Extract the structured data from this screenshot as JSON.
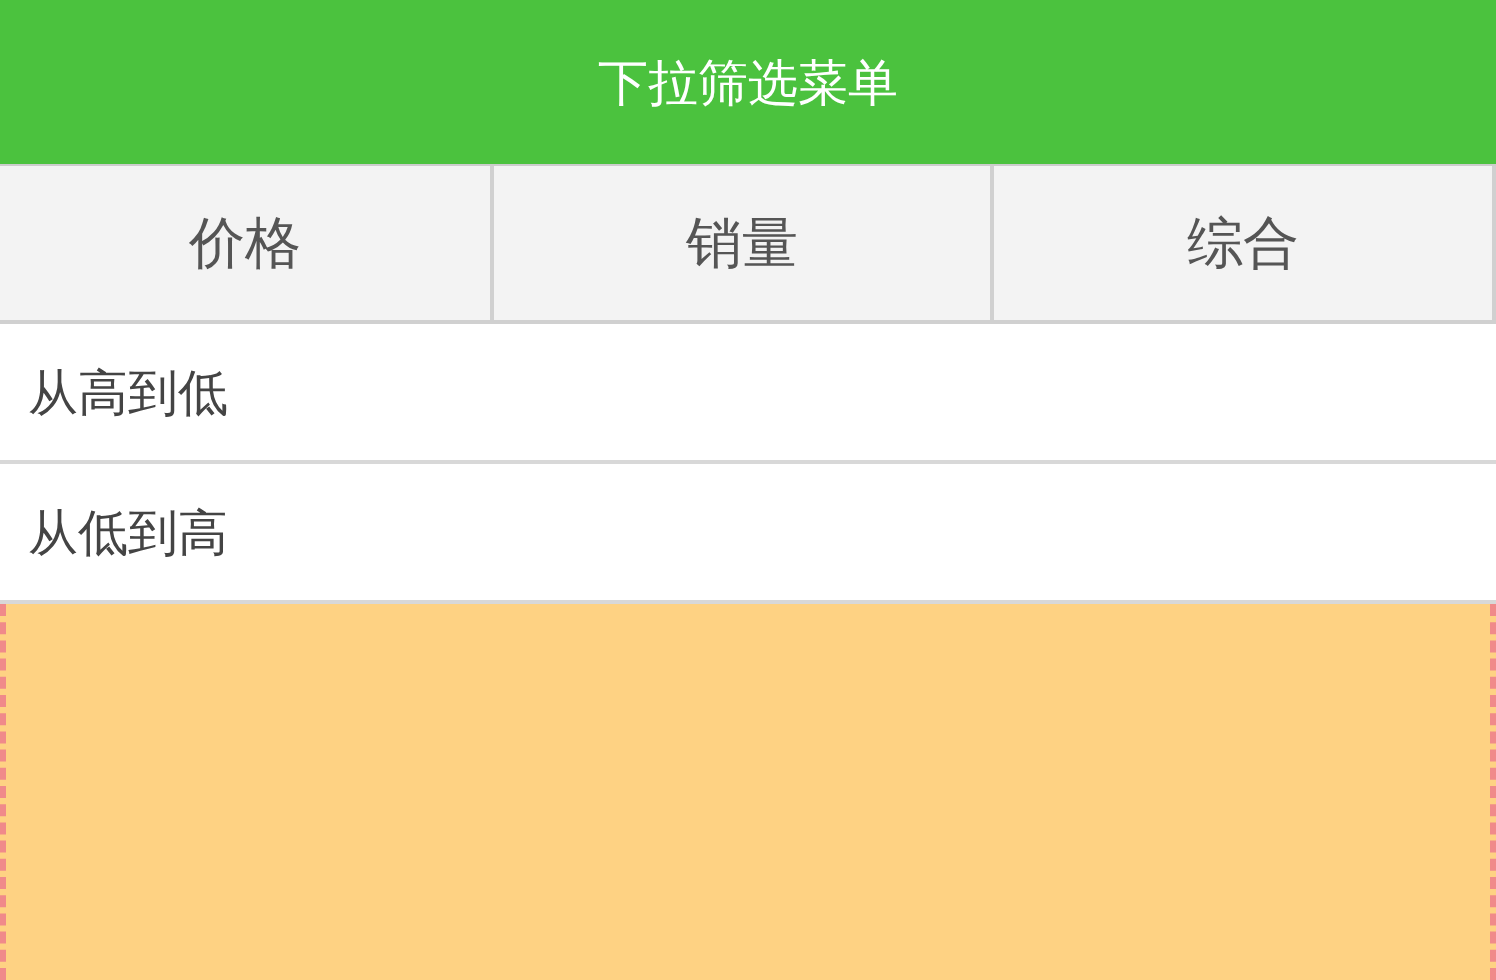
{
  "header": {
    "title": "下拉筛选菜单"
  },
  "filter_tabs": [
    {
      "label": "价格"
    },
    {
      "label": "销量"
    },
    {
      "label": "综合"
    }
  ],
  "dropdown_options": [
    {
      "label": "从高到低"
    },
    {
      "label": "从低到高"
    }
  ]
}
